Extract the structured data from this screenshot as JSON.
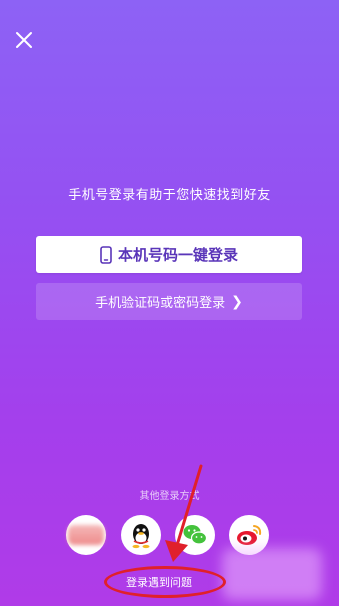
{
  "header": {
    "close_icon": "close-icon"
  },
  "subtitle": "手机号登录有助于您快速找到好友",
  "primary_button": {
    "label": "本机号码一键登录",
    "icon": "phone-icon"
  },
  "secondary_button": {
    "label": "手机验证码或密码登录",
    "chevron": "❯"
  },
  "other_methods": {
    "label": "其他登录方式",
    "providers": [
      "blurred-provider",
      "qq",
      "wechat",
      "weibo"
    ]
  },
  "help_link": "登录遇到问题",
  "annotation_color": "#e0202b"
}
